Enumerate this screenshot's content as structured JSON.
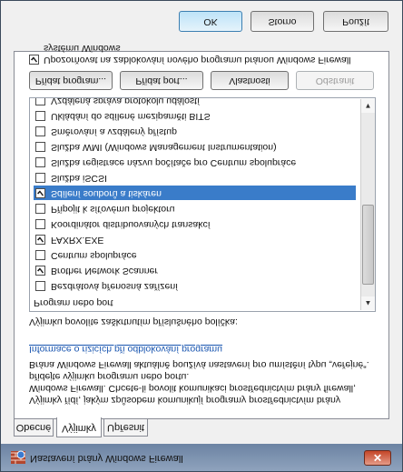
{
  "window": {
    "title": "Nastavení brány Windows Firewall",
    "close_label": "✕"
  },
  "tabs": [
    {
      "label": "Obecné"
    },
    {
      "label": "Výjimky"
    },
    {
      "label": "Upřesnit"
    }
  ],
  "exceptions": {
    "description": "Výjimky řídí, jakým způsobem komunikují programy prostřednictvím brány Windows Firewall. Chcete-li povolit komunikaci prostřednictvím brány firewall, přidejte výjimku programu nebo portu.",
    "current_policy": "Brána Windows Firewall aktuálně používá nastavení pro umístění typu „veřejné“.",
    "link": "Informace o rizicích při odblokování programu",
    "enable_label": "Výjimku povolíte zaškrtnutím příslušného políčka:",
    "list_header": "Program nebo port",
    "items": [
      {
        "label": "Bezdrátová přenosná zařízení",
        "checked": false,
        "selected": false
      },
      {
        "label": "Brother Network Scanner",
        "checked": true,
        "selected": false
      },
      {
        "label": "Centrum spolupráce",
        "checked": false,
        "selected": false
      },
      {
        "label": "FAXRX.EXE",
        "checked": true,
        "selected": false
      },
      {
        "label": "Koordinátor distribuovaných transakcí",
        "checked": false,
        "selected": false
      },
      {
        "label": "Připojit k síťovému projektoru",
        "checked": false,
        "selected": false
      },
      {
        "label": "Sdílení souborů a tiskáren",
        "checked": true,
        "selected": true
      },
      {
        "label": "Služba iSCSI",
        "checked": false,
        "selected": false
      },
      {
        "label": "Služba registrace názvu počítače pro Centrum spolupráce",
        "checked": false,
        "selected": false
      },
      {
        "label": "Služba WMI (Windows Management Instrumentation)",
        "checked": false,
        "selected": false
      },
      {
        "label": "Směrování a vzdálený přístup",
        "checked": false,
        "selected": false
      },
      {
        "label": "Ukládání do sdílené mezipaměti BITS",
        "checked": false,
        "selected": false
      },
      {
        "label": "Vzdálená správa protokolu událostí",
        "checked": false,
        "selected": false
      }
    ],
    "buttons": {
      "add_program": "Přidat program...",
      "add_port": "Přidat port...",
      "properties": "Vlastnosti",
      "remove": "Odstranit"
    },
    "notify_label": "Upozorňovat na zablokování nového programu bránou Windows Firewall systému Windows",
    "notify_checked": true
  },
  "dialog_buttons": {
    "ok": "OK",
    "cancel": "Storno",
    "apply": "Použít"
  }
}
